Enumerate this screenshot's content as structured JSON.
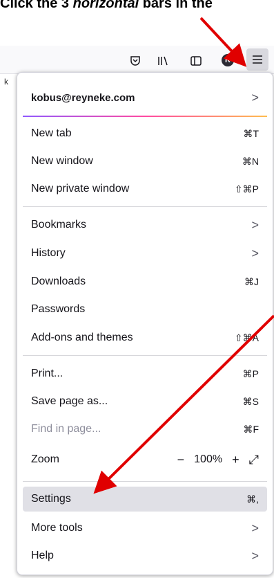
{
  "caption": {
    "prefix": "Click the 3 ",
    "em": "horizontal",
    "suffix": " bars in the"
  },
  "toolbar": {
    "icons": [
      "pocket-icon",
      "library-icon",
      "sidebar-icon",
      "account-avatar",
      "hamburger-menu-icon"
    ],
    "avatar_letter": "K"
  },
  "tab_stub": "k",
  "menu": {
    "account": {
      "email": "kobus@reyneke.com",
      "chevron": ">"
    },
    "group1": [
      {
        "label": "New tab",
        "shortcut": "⌘T"
      },
      {
        "label": "New window",
        "shortcut": "⌘N"
      },
      {
        "label": "New private window",
        "shortcut": "⇧⌘P"
      }
    ],
    "group2": [
      {
        "label": "Bookmarks",
        "shortcut": ">"
      },
      {
        "label": "History",
        "shortcut": ">"
      },
      {
        "label": "Downloads",
        "shortcut": "⌘J"
      },
      {
        "label": "Passwords",
        "shortcut": ""
      },
      {
        "label": "Add-ons and themes",
        "shortcut": "⇧⌘A"
      }
    ],
    "group3": [
      {
        "label": "Print...",
        "shortcut": "⌘P"
      },
      {
        "label": "Save page as...",
        "shortcut": "⌘S"
      },
      {
        "label": "Find in page...",
        "shortcut": "⌘F"
      }
    ],
    "zoom": {
      "label": "Zoom",
      "minus": "−",
      "value": "100%",
      "plus": "+",
      "fullscreen": "⤢"
    },
    "group4": [
      {
        "label": "Settings",
        "shortcut": "⌘,"
      },
      {
        "label": "More tools",
        "shortcut": ">"
      },
      {
        "label": "Help",
        "shortcut": ">"
      }
    ]
  },
  "colors": {
    "arrow": "#e00000",
    "highlight": "#e0e0e6"
  }
}
